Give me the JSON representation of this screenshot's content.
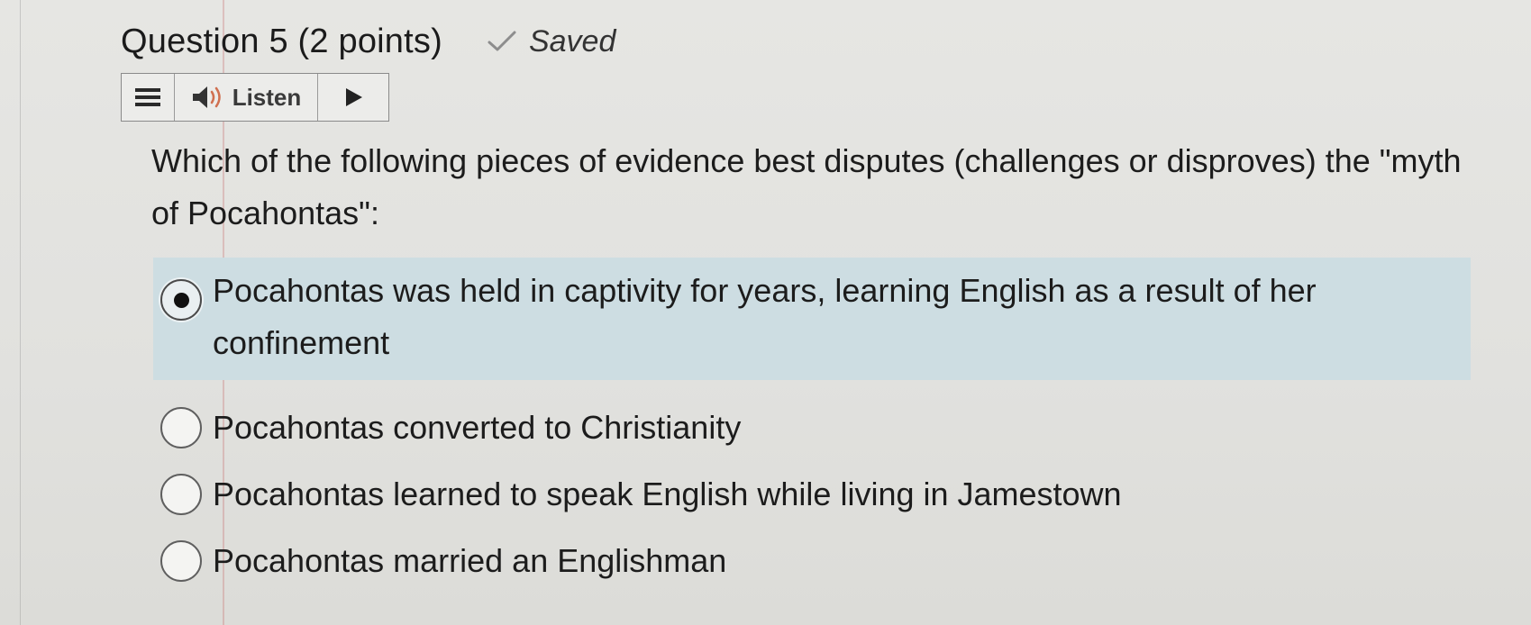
{
  "question": {
    "title": "Question 5 (2 points)",
    "status": "Saved",
    "prompt": "Which of the following pieces of evidence best disputes (challenges or disproves) the \"myth of Pocahontas\":"
  },
  "toolbar": {
    "menu_icon": "menu-icon",
    "speaker_icon": "speaker-icon",
    "listen_label": "Listen",
    "play_icon": "play-icon"
  },
  "options": [
    {
      "label": "Pocahontas was held in captivity for years, learning English as a result of her confinement",
      "selected": true
    },
    {
      "label": "Pocahontas converted to Christianity",
      "selected": false
    },
    {
      "label": "Pocahontas learned to speak English while living in Jamestown",
      "selected": false
    },
    {
      "label": "Pocahontas married an Englishman",
      "selected": false
    }
  ],
  "colors": {
    "selected_bg": "#cddde2",
    "page_bg": "#e3e3e0"
  }
}
